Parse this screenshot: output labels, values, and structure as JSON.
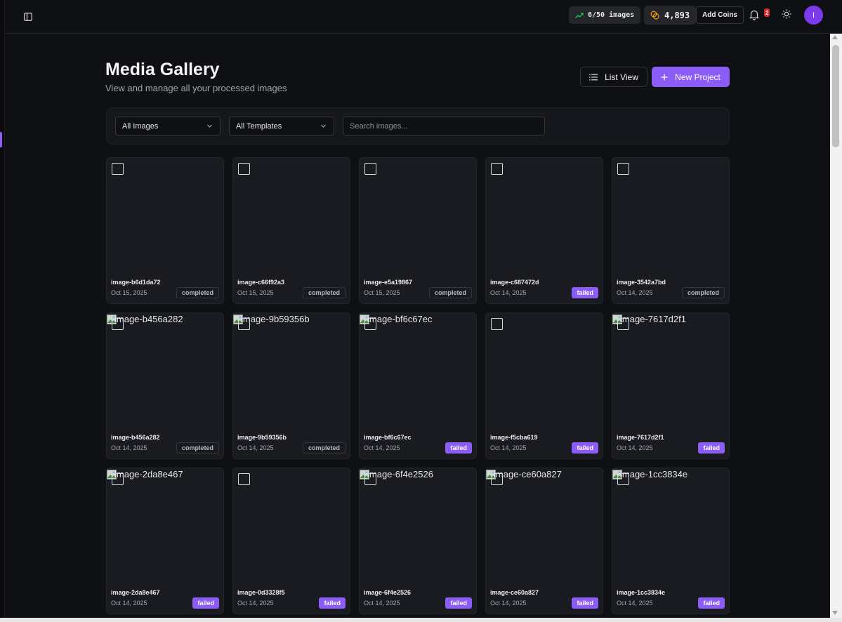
{
  "header": {
    "quota_text": "6/50 images",
    "coins_text": "4,893",
    "add_coins_label": "Add Coins",
    "notification_count": "2",
    "avatar_initial": "I"
  },
  "page": {
    "title": "Media Gallery",
    "subtitle": "View and manage all your processed images",
    "list_view_label": "List View",
    "new_project_label": "New Project"
  },
  "filters": {
    "status_selected": "All Images",
    "template_selected": "All Templates",
    "search_placeholder": "Search images...",
    "search_value": ""
  },
  "colors": {
    "accent": "#8b5cf6",
    "quota_trend": "#22c55e",
    "coin": "#f59e0b",
    "badge_red": "#dc2626"
  },
  "gallery": [
    {
      "name": "image-b6d1da72",
      "date": "Oct 15, 2025",
      "status": "completed",
      "alt_text": ""
    },
    {
      "name": "image-c66f92a3",
      "date": "Oct 15, 2025",
      "status": "completed",
      "alt_text": ""
    },
    {
      "name": "image-e5a19867",
      "date": "Oct 15, 2025",
      "status": "completed",
      "alt_text": ""
    },
    {
      "name": "image-c687472d",
      "date": "Oct 14, 2025",
      "status": "failed",
      "alt_text": ""
    },
    {
      "name": "image-3542a7bd",
      "date": "Oct 14, 2025",
      "status": "completed",
      "alt_text": ""
    },
    {
      "name": "image-b456a282",
      "date": "Oct 14, 2025",
      "status": "completed",
      "alt_text": "image-b456a282"
    },
    {
      "name": "image-9b59356b",
      "date": "Oct 14, 2025",
      "status": "completed",
      "alt_text": "image-9b59356b"
    },
    {
      "name": "image-bf6c67ec",
      "date": "Oct 14, 2025",
      "status": "failed",
      "alt_text": "image-bf6c67ec"
    },
    {
      "name": "image-f5cba619",
      "date": "Oct 14, 2025",
      "status": "failed",
      "alt_text": ""
    },
    {
      "name": "image-7617d2f1",
      "date": "Oct 14, 2025",
      "status": "failed",
      "alt_text": "image-7617d2f1"
    },
    {
      "name": "image-2da8e467",
      "date": "Oct 14, 2025",
      "status": "failed",
      "alt_text": "image-2da8e467"
    },
    {
      "name": "image-0d3328f5",
      "date": "Oct 14, 2025",
      "status": "failed",
      "alt_text": ""
    },
    {
      "name": "image-6f4e2526",
      "date": "Oct 14, 2025",
      "status": "failed",
      "alt_text": "image-6f4e2526"
    },
    {
      "name": "image-ce60a827",
      "date": "Oct 14, 2025",
      "status": "failed",
      "alt_text": "image-ce60a827"
    },
    {
      "name": "image-1cc3834e",
      "date": "Oct 14, 2025",
      "status": "failed",
      "alt_text": "image-1cc3834e"
    }
  ]
}
